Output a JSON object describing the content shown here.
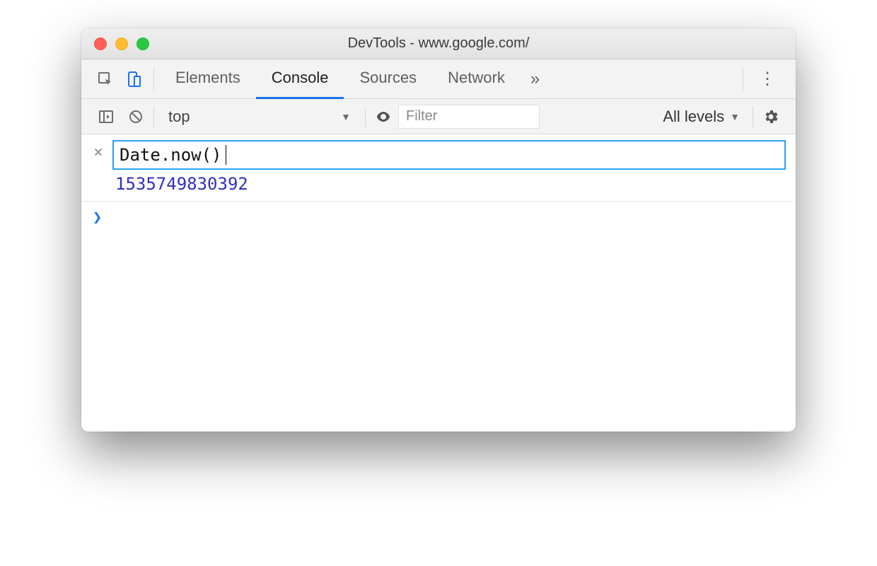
{
  "window": {
    "title": "DevTools - www.google.com/"
  },
  "tabs": {
    "items": [
      "Elements",
      "Console",
      "Sources",
      "Network"
    ],
    "active_index": 1,
    "overflow_glyph": "»"
  },
  "filter": {
    "context": "top",
    "placeholder": "Filter",
    "levels_label": "All levels"
  },
  "console": {
    "expression": "Date.now()",
    "result": "1535749830392",
    "prompt_glyph": "❯"
  },
  "icons": {
    "close_small": "×",
    "dropdown_tri": "▼",
    "kebab": "⋮"
  }
}
